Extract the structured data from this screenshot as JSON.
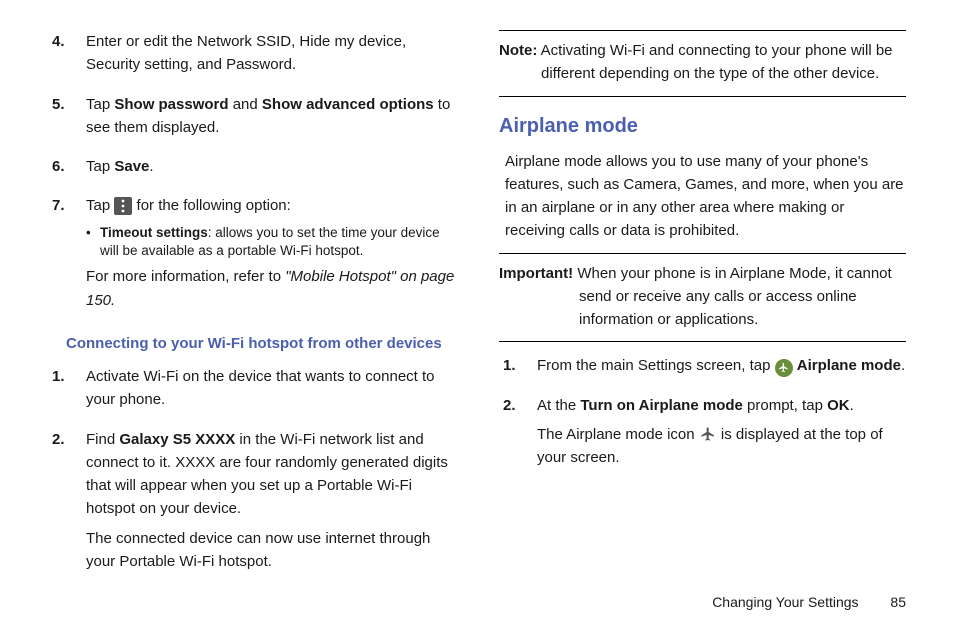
{
  "left": {
    "steps_a": [
      {
        "num": "4.",
        "body": [
          {
            "t": "plain",
            "v": "Enter or edit the Network SSID, Hide my device, Security setting, and Password."
          }
        ]
      },
      {
        "num": "5.",
        "body": [
          {
            "t": "plain",
            "v": "Tap "
          },
          {
            "t": "bold",
            "v": "Show password"
          },
          {
            "t": "plain",
            "v": " and "
          },
          {
            "t": "bold",
            "v": "Show advanced options"
          },
          {
            "t": "plain",
            "v": " to see them displayed."
          }
        ]
      },
      {
        "num": "6.",
        "body": [
          {
            "t": "plain",
            "v": "Tap "
          },
          {
            "t": "bold",
            "v": "Save"
          },
          {
            "t": "plain",
            "v": "."
          }
        ]
      },
      {
        "num": "7.",
        "body": [
          {
            "t": "plain",
            "v": "Tap "
          },
          {
            "t": "icon",
            "v": "menu"
          },
          {
            "t": "plain",
            "v": " for the following option:"
          }
        ],
        "sub_bullet_bold": "Timeout settings",
        "sub_bullet_rest": ": allows you to set the time your device will be available as a portable Wi-Fi hotspot.",
        "after_pre": "For more information, refer to ",
        "after_ital": "\"Mobile Hotspot\"  on page 150."
      }
    ],
    "subhead": "Connecting to your Wi-Fi hotspot from other devices",
    "steps_b": [
      {
        "num": "1.",
        "lines": [
          [
            {
              "t": "plain",
              "v": "Activate Wi-Fi on the device that wants to connect to your phone."
            }
          ]
        ]
      },
      {
        "num": "2.",
        "lines": [
          [
            {
              "t": "plain",
              "v": "Find "
            },
            {
              "t": "bold",
              "v": "Galaxy S5 XXXX"
            },
            {
              "t": "plain",
              "v": " in the Wi-Fi network list and connect to it. XXXX are four randomly generated digits that will appear when you set up a Portable Wi-Fi hotspot on your device."
            }
          ],
          [
            {
              "t": "plain",
              "v": "The connected device can now use internet through your Portable Wi-Fi hotspot."
            }
          ]
        ]
      }
    ]
  },
  "right": {
    "note_label": "Note:",
    "note_text": " Activating Wi-Fi and connecting to your phone will be different depending on the type of the other device.",
    "section": "Airplane mode",
    "intro": "Airplane mode allows you to use many of your phone's features, such as Camera, Games, and more, when you are in an airplane or in any other area where making or receiving calls or data is prohibited.",
    "important_label": "Important!",
    "important_text": " When your phone is in Airplane Mode, it cannot send or receive any calls or access online information or applications.",
    "steps": [
      {
        "num": "1.",
        "body": [
          {
            "t": "plain",
            "v": "From the main Settings screen, tap "
          },
          {
            "t": "icon",
            "v": "plane-circle"
          },
          {
            "t": "plain",
            "v": " "
          },
          {
            "t": "bold",
            "v": "Airplane mode"
          },
          {
            "t": "plain",
            "v": "."
          }
        ]
      },
      {
        "num": "2.",
        "lines": [
          [
            {
              "t": "plain",
              "v": "At the "
            },
            {
              "t": "bold",
              "v": "Turn on Airplane mode"
            },
            {
              "t": "plain",
              "v": " prompt, tap "
            },
            {
              "t": "bold",
              "v": "OK"
            },
            {
              "t": "plain",
              "v": "."
            }
          ],
          [
            {
              "t": "plain",
              "v": "The Airplane mode icon "
            },
            {
              "t": "icon",
              "v": "plane-outline"
            },
            {
              "t": "plain",
              "v": " is displayed at the top of your screen."
            }
          ]
        ]
      }
    ]
  },
  "footer": {
    "chapter": "Changing Your Settings",
    "page": "85"
  }
}
